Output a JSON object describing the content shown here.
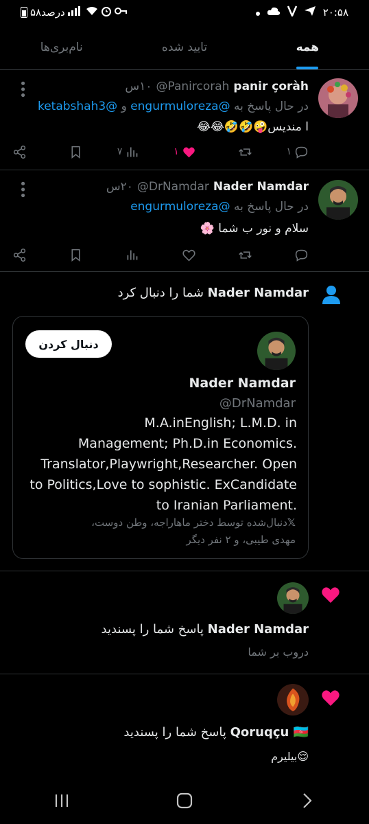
{
  "status_bar": {
    "time": "۲۰:۵۸",
    "battery_text": "۵۸درصد",
    "signal_text": "all",
    "left_icons": [
      "battery-icon",
      "signal-icon",
      "wifi-icon",
      "alarm-icon",
      "key-icon"
    ],
    "right_icons": [
      "send-icon",
      "vpn-icon",
      "cloud-icon",
      "dot-icon"
    ]
  },
  "tabs": [
    {
      "label": "همه",
      "active": true
    },
    {
      "label": "تایید شده",
      "active": false
    },
    {
      "label": "نام‌بری‌ها",
      "active": false
    }
  ],
  "tweets": [
    {
      "name": "panir çoràh",
      "handle": "@Panircorah",
      "time": "۱۰س",
      "replying_prefix": "در حال پاسخ به",
      "mention_1": "@engurmuloreza",
      "and_word": "و",
      "mention_2": "@ketabshah3",
      "text": "ا مندیس🤪🤣🤣😂😂",
      "reply_count": "۱",
      "like_count": "۱",
      "views_count": "۷",
      "liked": true
    },
    {
      "name": "Nader Namdar",
      "handle": "@DrNamdar",
      "time": "۲۰س",
      "replying_prefix": "در حال پاسخ به",
      "mention_1": "@engurmuloreza",
      "text": "سلام و نور ب شما 🌸",
      "liked": false
    }
  ],
  "follow_notification": {
    "name": "Nader Namdar",
    "action": "شما را دنبال کرد",
    "card": {
      "follow_button": "دنبال کردن",
      "name": "Nader Namdar",
      "handle": "@DrNamdar",
      "bio_lines": [
        "M.A.inEnglish; L.M.D. in",
        "Management; Ph.D.in Economics.",
        "Translator,Playwright,Researcher. Open",
        "to Politics,Love to sophistic. ExCandidate",
        "to Iranian Parliament."
      ],
      "followed_by_line1": "دنبال‌شده توسط دختر ماهاراجه، وطن دوست،",
      "followed_by_line2": "مهدی طیبی، و ۲ نفر دیگر",
      "x_logo": "𝕏"
    }
  },
  "like_notifications": [
    {
      "name": "Nader Namdar",
      "action": "پاسخ شما را پسندید",
      "excerpt": "دروب بر شما"
    },
    {
      "name": "Qoruqçu 🇦🇿",
      "action": "پاسخ شما را پسندید",
      "excerpt": "😌بیلیرم"
    }
  ],
  "colors": {
    "accent": "#1d9bf0",
    "like": "#f91880",
    "muted": "#71767b",
    "border": "#2f3336",
    "background": "#000000"
  },
  "nav_bar": [
    "recents-icon",
    "home-icon",
    "back-icon"
  ]
}
